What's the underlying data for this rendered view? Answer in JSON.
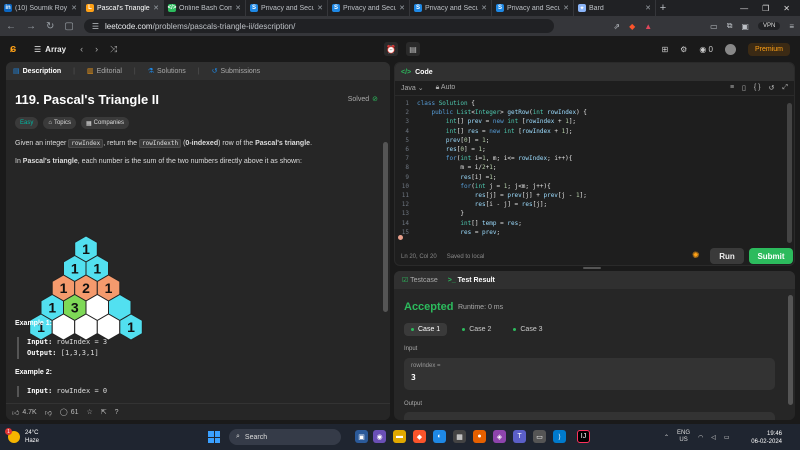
{
  "browser": {
    "tabs": [
      {
        "label": "(10) Soumik Roy | Linkedin",
        "icon": "linkedin-icon",
        "color": "#0a66c2",
        "glyph": "in"
      },
      {
        "label": "Pascal's Triangle II - LeetCode",
        "icon": "leetcode-icon",
        "color": "#ffa116",
        "glyph": "L",
        "active": true
      },
      {
        "label": "Online Bash Compiler - online",
        "icon": "code-icon",
        "color": "#2cbb5d",
        "glyph": "</>"
      },
      {
        "label": "Privacy and Security in Online",
        "icon": "s-icon",
        "color": "#1e88e5",
        "glyph": "S"
      },
      {
        "label": "Privacy and Security in Online",
        "icon": "s-icon",
        "color": "#1e88e5",
        "glyph": "S"
      },
      {
        "label": "Privacy and Security in Online",
        "icon": "s-icon",
        "color": "#1e88e5",
        "glyph": "S"
      },
      {
        "label": "Privacy and Security in Online",
        "icon": "s-icon",
        "color": "#1e88e5",
        "glyph": "S"
      },
      {
        "label": "Bard",
        "icon": "bard-icon",
        "color": "#8ab4f8",
        "glyph": "✦"
      }
    ],
    "new_tab": "+",
    "url_domain": "leetcode.com",
    "url_path": "/problems/pascals-triangle-ii/description/",
    "vpn_label": "VPN"
  },
  "header": {
    "list_label": "Array",
    "premium_label": "Premium",
    "notification_count": "0"
  },
  "left": {
    "tabs": [
      "Description",
      "Editorial",
      "Solutions",
      "Submissions"
    ],
    "title": "119. Pascal's Triangle II",
    "solved_label": "Solved",
    "tags": [
      "Easy",
      "Topics",
      "Companies"
    ],
    "desc1_a": "Given an integer ",
    "desc1_code": "rowIndex",
    "desc1_b": ", return the ",
    "desc1_code2": "rowIndexth",
    "desc1_c": " (",
    "desc1_bold": "0-indexed",
    "desc1_d": ") row of the ",
    "desc1_bold2": "Pascal's triangle",
    "desc1_e": ".",
    "desc2_a": "In ",
    "desc2_bold": "Pascal's triangle",
    "desc2_b": ", each number is the sum of the two numbers directly above it as shown:",
    "triangle_rows": [
      [
        "1"
      ],
      [
        "1",
        "1"
      ],
      [
        "1",
        "2",
        "1"
      ],
      [
        "1",
        "3",
        "",
        ""
      ],
      [
        "1",
        "",
        "",
        "",
        "1"
      ]
    ],
    "example1_title": "Example 1:",
    "example1_input_label": "Input:",
    "example1_input": "rowIndex = 3",
    "example1_output_label": "Output:",
    "example1_output": "[1,3,3,1]",
    "example2_title": "Example 2:",
    "example2_input_label": "Input:",
    "example2_input": "rowIndex = 0",
    "likes": "4.7K",
    "comments": "61"
  },
  "code": {
    "tab_label": "Code",
    "language": "Java",
    "mode": "Auto",
    "lines": [
      {
        "n": "1",
        "t": "class Solution {"
      },
      {
        "n": "2",
        "t": "    public List<Integer> getRow(int rowIndex) {"
      },
      {
        "n": "3",
        "t": "        int[] prev = new int [rowIndex + 1];"
      },
      {
        "n": "4",
        "t": "        int[] res = new int [rowIndex + 1];"
      },
      {
        "n": "5",
        "t": "        prev[0] = 1;"
      },
      {
        "n": "6",
        "t": "        res[0] = 1;"
      },
      {
        "n": "7",
        "t": "        for(int i=1, m; i<= rowIndex; i++){"
      },
      {
        "n": "8",
        "t": "            m = i/2+1;"
      },
      {
        "n": "9",
        "t": "            res[i] =1;"
      },
      {
        "n": "10",
        "t": "            for(int j = 1; j<m; j++){"
      },
      {
        "n": "11",
        "t": "                res[j] = prev[j] + prev[j - 1];"
      },
      {
        "n": "12",
        "t": "                res[i - j] = res[j];"
      },
      {
        "n": "13",
        "t": "            }"
      },
      {
        "n": "14",
        "t": "            int[] temp = res;"
      },
      {
        "n": "15",
        "t": "            res = prev;"
      }
    ],
    "status_pos": "Ln 20, Col 20",
    "status_saved": "Saved to local",
    "run_label": "Run",
    "submit_label": "Submit"
  },
  "test": {
    "tabs": [
      "Testcase",
      "Test Result"
    ],
    "result": "Accepted",
    "runtime": "Runtime: 0 ms",
    "cases": [
      "Case 1",
      "Case 2",
      "Case 3"
    ],
    "input_label": "Input",
    "input_key": "rowIndex =",
    "input_value": "3",
    "output_label": "Output"
  },
  "taskbar": {
    "temp": "24°C",
    "weather": "Haze",
    "weather_badge": "1",
    "search_label": "Search",
    "lang1": "ENG",
    "lang2": "US",
    "time": "19:46",
    "date": "06-02-2024"
  }
}
